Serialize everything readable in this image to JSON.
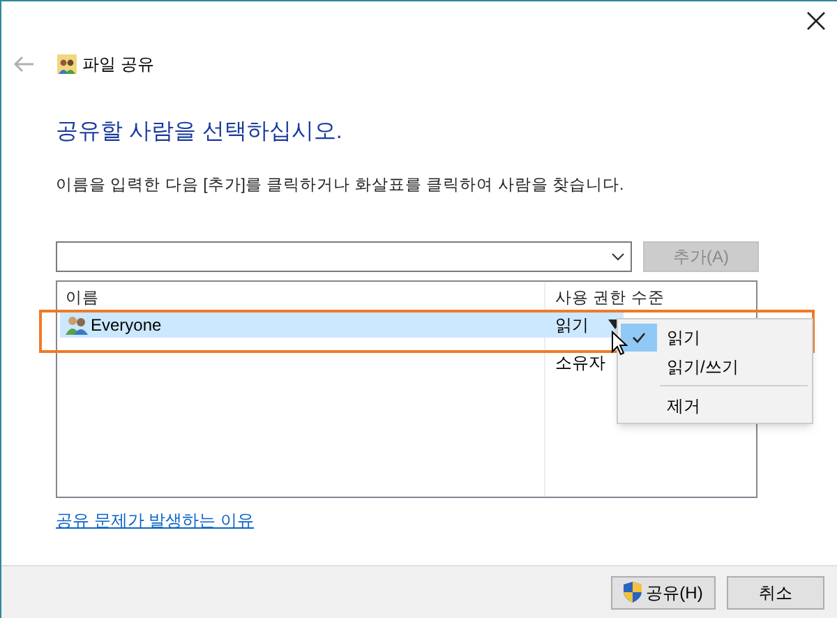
{
  "window": {
    "title": "파일 공유"
  },
  "heading": "공유할 사람을 선택하십시오.",
  "instruction": "이름을 입력한 다음 [추가]를 클릭하거나 화살표를 클릭하여 사람을 찾습니다.",
  "add_button": {
    "label": "추가(A)",
    "disabled": true
  },
  "table": {
    "columns": [
      "이름",
      "사용 권한 수준"
    ],
    "rows": [
      {
        "name": "Everyone",
        "permission": "읽기",
        "selected": true
      },
      {
        "permission": "소유자",
        "selected": false
      }
    ]
  },
  "context_menu": [
    {
      "kind": "item",
      "label": "읽기",
      "checked": true
    },
    {
      "kind": "item",
      "label": "읽기/쓰기",
      "checked": false
    },
    {
      "kind": "separator"
    },
    {
      "kind": "item",
      "label": "제거",
      "checked": false
    }
  ],
  "link": "공유 문제가 발생하는 이유",
  "buttons": [
    {
      "kind": "shield",
      "label": "공유(H)"
    },
    {
      "kind": "plain",
      "label": "취소"
    }
  ]
}
